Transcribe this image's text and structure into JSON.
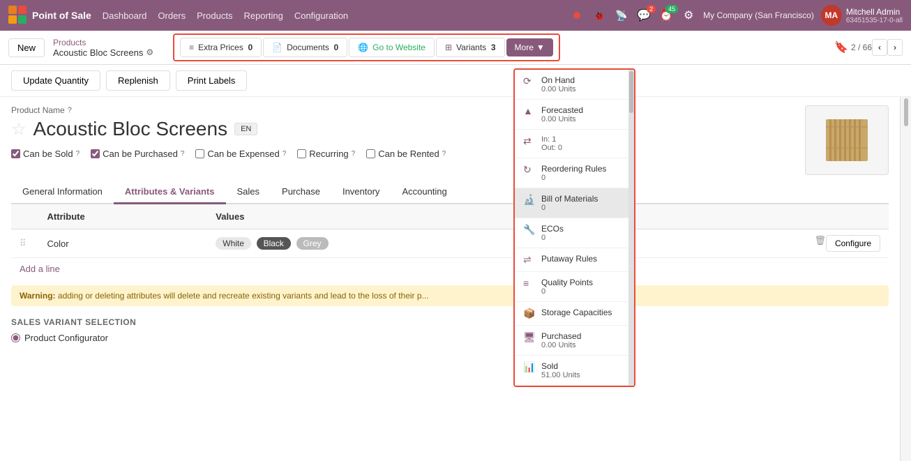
{
  "app": {
    "name": "Point of Sale",
    "logo_letters": "PS"
  },
  "topnav": {
    "menu_items": [
      "Dashboard",
      "Orders",
      "Products",
      "Reporting",
      "Configuration"
    ],
    "notifications": {
      "chat_count": "2",
      "activity_count": "45"
    },
    "company": "My Company (San Francisco)",
    "user": {
      "name": "Mitchell Admin",
      "id": "63451535-17-0-all",
      "initials": "MA"
    }
  },
  "breadcrumb": {
    "new_label": "New",
    "parent_label": "Products",
    "current_label": "Acoustic Bloc Screens"
  },
  "toolbar": {
    "extra_prices_label": "Extra Prices",
    "extra_prices_count": "0",
    "documents_label": "Documents",
    "documents_count": "0",
    "go_to_website_label": "Go to Website",
    "variants_label": "Variants",
    "variants_count": "3",
    "more_label": "More"
  },
  "page_actions": {
    "update_quantity": "Update Quantity",
    "replenish": "Replenish",
    "print_labels": "Print Labels"
  },
  "form": {
    "product_name_label": "Product Name",
    "product_name": "Acoustic Bloc Screens",
    "can_be_sold": "Can be Sold",
    "can_be_purchased": "Can be Purchased",
    "can_be_expensed": "Can be Expensed",
    "recurring": "Recurring",
    "can_be_rented": "Can be Rented",
    "lang_badge": "EN"
  },
  "tabs": [
    {
      "id": "general",
      "label": "General Information"
    },
    {
      "id": "attributes",
      "label": "Attributes & Variants",
      "active": true
    },
    {
      "id": "sales",
      "label": "Sales"
    },
    {
      "id": "purchase",
      "label": "Purchase"
    },
    {
      "id": "inventory",
      "label": "Inventory"
    },
    {
      "id": "accounting",
      "label": "Accounting"
    }
  ],
  "attributes_table": {
    "col_attribute": "Attribute",
    "col_values": "Values",
    "rows": [
      {
        "attribute": "Color",
        "values": [
          "White",
          "Black",
          "Grey"
        ],
        "value_styles": [
          "white",
          "black",
          "grey"
        ]
      }
    ]
  },
  "buttons": {
    "add_line": "Add a line",
    "configure": "Configure"
  },
  "warning": "Warning: adding or deleting attributes will delete and recreate existing variants and lead to the loss of their p...",
  "sales_variant": {
    "title": "SALES VARIANT SELECTION",
    "option": "Product Configurator"
  },
  "dropdown": {
    "items": [
      {
        "id": "on_hand",
        "icon": "⟳",
        "label": "On Hand",
        "count": "0.00 Units"
      },
      {
        "id": "forecasted",
        "icon": "▲",
        "label": "Forecasted",
        "count": "0.00 Units"
      },
      {
        "id": "in_out",
        "icon": "⇄",
        "label": "",
        "count": "In: 1\nOut: 0"
      },
      {
        "id": "reordering",
        "icon": "↻",
        "label": "Reordering Rules",
        "count": "0"
      },
      {
        "id": "bom",
        "icon": "🔬",
        "label": "Bill of Materials",
        "count": "0",
        "highlighted": true
      },
      {
        "id": "ecos",
        "icon": "🔧",
        "label": "ECOs",
        "count": "0"
      },
      {
        "id": "putaway",
        "icon": "⇌",
        "label": "Putaway Rules",
        "count": ""
      },
      {
        "id": "quality",
        "icon": "≡",
        "label": "Quality Points",
        "count": "0"
      },
      {
        "id": "storage",
        "icon": "📦",
        "label": "Storage Capacities",
        "count": ""
      },
      {
        "id": "purchased",
        "icon": "🖥",
        "label": "Purchased",
        "count": "0.00 Units"
      },
      {
        "id": "sold",
        "icon": "📊",
        "label": "Sold",
        "count": "51.00 Units"
      }
    ]
  },
  "pagination": {
    "current": "2",
    "total": "66"
  }
}
